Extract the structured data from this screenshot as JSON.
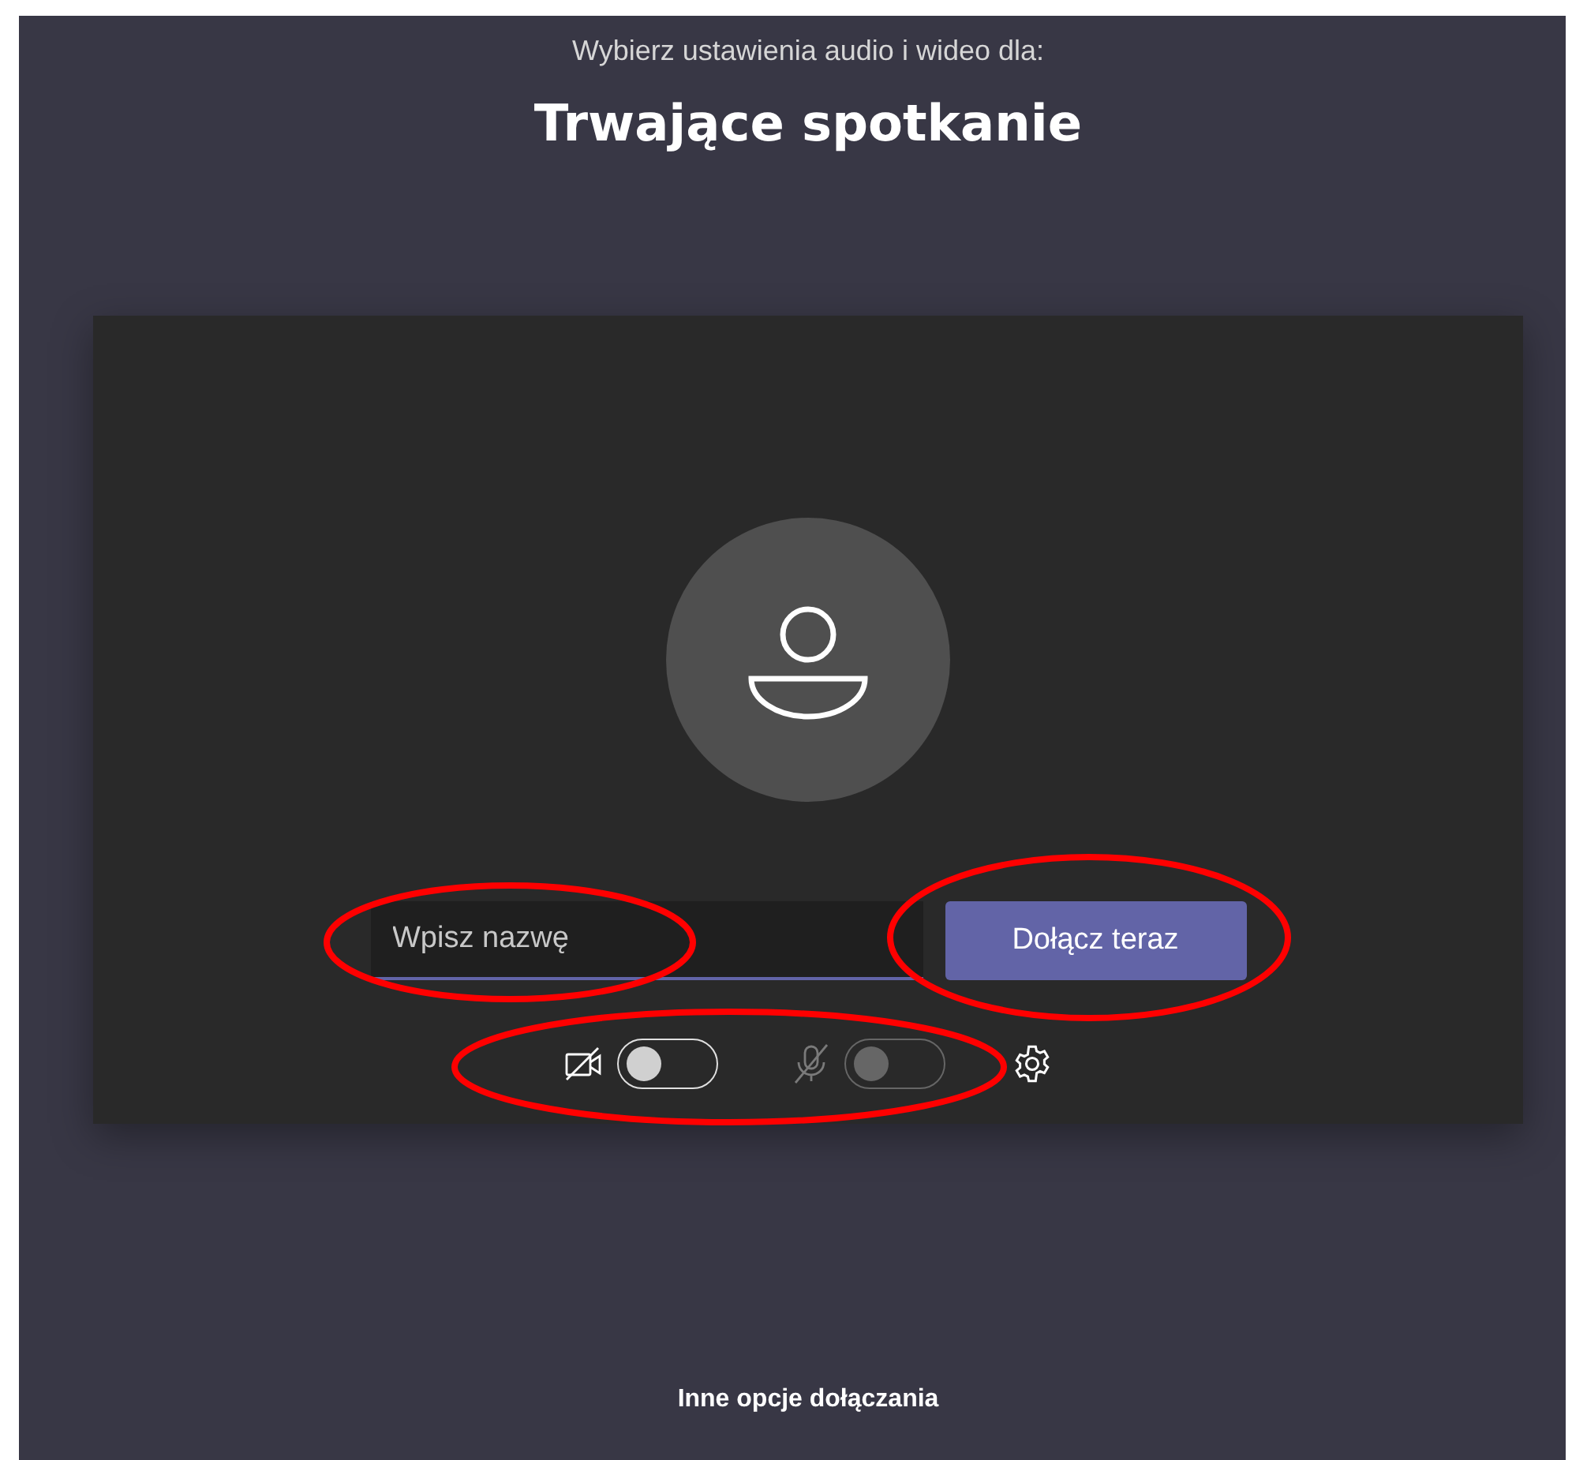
{
  "header": {
    "subtitle": "Wybierz ustawienia audio i wideo dla:",
    "title": "Trwające spotkanie"
  },
  "name_field": {
    "placeholder": "Wpisz nazwę"
  },
  "join_button": {
    "label": "Dołącz teraz"
  },
  "toggles": [
    {
      "kind": "camera",
      "on": false,
      "disabled": false
    },
    {
      "kind": "microphone",
      "on": false,
      "disabled": true
    }
  ],
  "footer_link": "Inne opcje dołączania"
}
